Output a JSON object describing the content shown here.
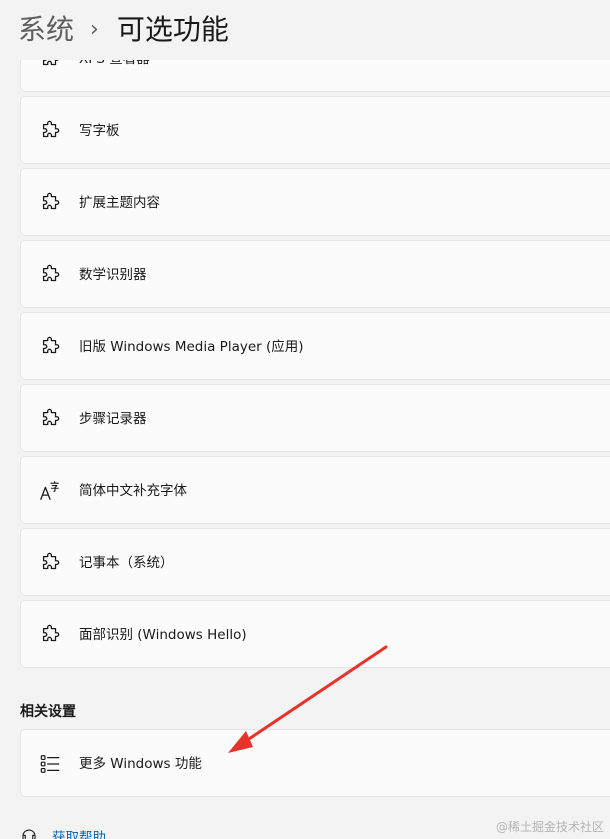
{
  "header": {
    "parent": "系统",
    "separator": "›",
    "current": "可选功能"
  },
  "features": [
    {
      "label": "XPS 查看器",
      "icon": "puzzle-icon"
    },
    {
      "label": "写字板",
      "icon": "puzzle-icon"
    },
    {
      "label": "扩展主题内容",
      "icon": "puzzle-icon"
    },
    {
      "label": "数学识别器",
      "icon": "puzzle-icon"
    },
    {
      "label": "旧版 Windows Media Player (应用)",
      "icon": "puzzle-icon"
    },
    {
      "label": "步骤记录器",
      "icon": "puzzle-icon"
    },
    {
      "label": "简体中文补充字体",
      "icon": "font-icon"
    },
    {
      "label": "记事本（系统）",
      "icon": "puzzle-icon"
    },
    {
      "label": "面部识别 (Windows Hello)",
      "icon": "puzzle-icon"
    }
  ],
  "related": {
    "title": "相关设置",
    "more_features": {
      "label": "更多 Windows 功能",
      "icon": "list-icon"
    }
  },
  "help": {
    "label": "获取帮助",
    "icon": "help-icon"
  },
  "watermark": "@稀土掘金技术社区",
  "colors": {
    "background": "#f3f3f3",
    "card": "#fbfbfb",
    "link": "#0067c0",
    "annotation_arrow": "#e8322a"
  }
}
